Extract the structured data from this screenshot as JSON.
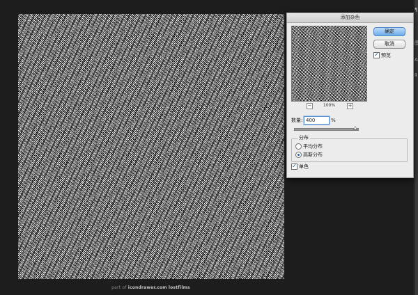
{
  "dialog": {
    "title": "添加杂色",
    "ok_label": "确定",
    "cancel_label": "取消",
    "preview_label": "预览",
    "preview_checked": true,
    "zoom": {
      "minus": "−",
      "value": "100%",
      "plus": "+"
    },
    "amount": {
      "label": "数量:",
      "value": "400",
      "unit": "%",
      "slider_fraction": 1.0
    },
    "distribution": {
      "label": "分布",
      "options": [
        {
          "label": "平均分布",
          "selected": false
        },
        {
          "label": "高斯分布",
          "selected": true
        }
      ]
    },
    "monochrome_label": "单色",
    "monochrome_checked": true
  },
  "footer": {
    "prefix": "part of",
    "site": "icondrawer.com",
    "brand": "lostfilms"
  },
  "right_panel": {
    "icons": [
      "¶",
      "图",
      "A",
      "Ⅱ"
    ]
  }
}
